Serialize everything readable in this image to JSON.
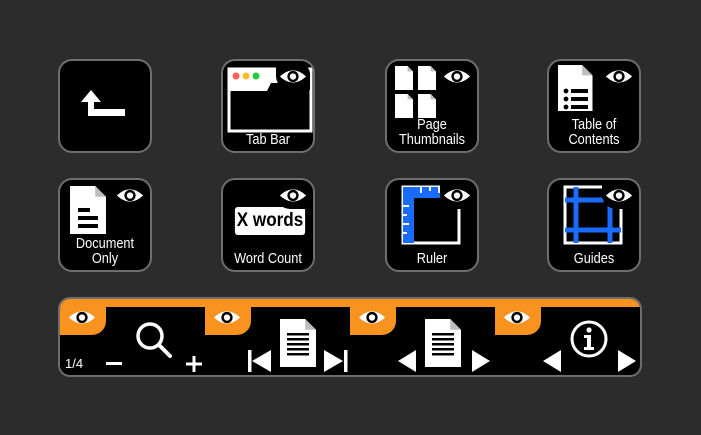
{
  "tiles": {
    "back": {
      "label": ""
    },
    "tab_bar": {
      "label": "Tab Bar"
    },
    "page_thumbnails": {
      "line1": "Page",
      "line2": "Thumbnails"
    },
    "table_of_contents": {
      "line1": "Table of",
      "line2": "Contents"
    },
    "document_only": {
      "line1": "Document",
      "line2": "Only"
    },
    "word_count": {
      "label": "Word Count",
      "badge": "X words"
    },
    "ruler": {
      "label": "Ruler"
    },
    "guides": {
      "label": "Guides"
    }
  },
  "toolbar": {
    "page_indicator": "1/4",
    "sections": [
      "zoom",
      "page-navigation",
      "document-navigation",
      "info-navigation"
    ]
  },
  "colors": {
    "background": "#2c2c2c",
    "tile": "#000000",
    "border": "#6e6e6e",
    "accent_orange": "#f7931e",
    "accent_blue": "#1a6cff",
    "traffic_red": "#ff5f56",
    "traffic_yellow": "#ffbd2e",
    "traffic_green": "#27c93f"
  },
  "icons": [
    "back-arrow-icon",
    "eye-icon",
    "browser-window-icon",
    "thumbnails-icon",
    "list-document-icon",
    "document-icon",
    "ruler-icon",
    "guides-icon",
    "magnifier-icon",
    "info-icon"
  ]
}
